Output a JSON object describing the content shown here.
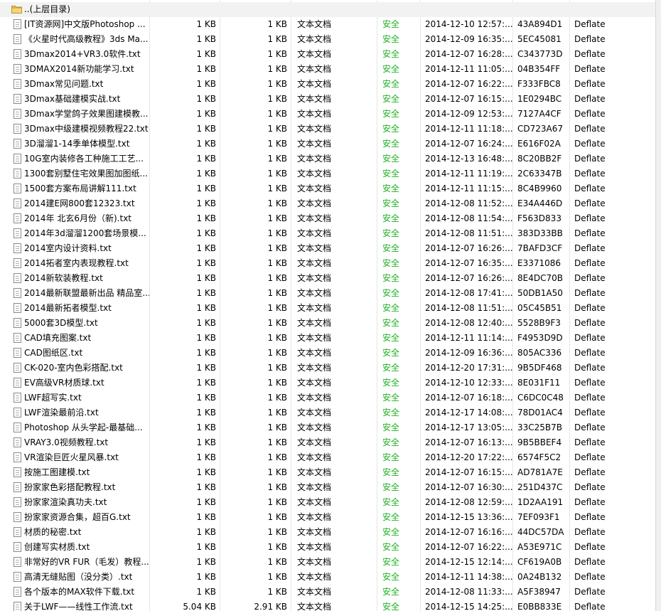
{
  "parent_row": {
    "name": "..(上层目录)",
    "icon": "folder-up-icon"
  },
  "colors": {
    "safe": "#1fb021",
    "parent_bg": "#f2f2f2"
  },
  "rows": [
    {
      "name": "[IT资源网]中文版Photoshop ...",
      "size": "1 KB",
      "packed": "1 KB",
      "type": "文本文档",
      "attr": "安全",
      "modified": "2014-12-10 12:57:...",
      "crc": "43A894D1",
      "method": "Deflate"
    },
    {
      "name": "《火星时代高级教程》3ds Ma...",
      "size": "1 KB",
      "packed": "1 KB",
      "type": "文本文档",
      "attr": "安全",
      "modified": "2014-12-09 16:35:...",
      "crc": "5EC45081",
      "method": "Deflate"
    },
    {
      "name": "3Dmax2014+VR3.0软件.txt",
      "size": "1 KB",
      "packed": "1 KB",
      "type": "文本文档",
      "attr": "安全",
      "modified": "2014-12-07 16:28:...",
      "crc": "C343773D",
      "method": "Deflate"
    },
    {
      "name": "3DMAX2014新功能学习.txt",
      "size": "1 KB",
      "packed": "1 KB",
      "type": "文本文档",
      "attr": "安全",
      "modified": "2014-12-11 11:05:...",
      "crc": "04B354FF",
      "method": "Deflate"
    },
    {
      "name": "3Dmax常见问题.txt",
      "size": "1 KB",
      "packed": "1 KB",
      "type": "文本文档",
      "attr": "安全",
      "modified": "2014-12-07 16:22:...",
      "crc": "F333FBC8",
      "method": "Deflate"
    },
    {
      "name": "3Dmax基础建模实战.txt",
      "size": "1 KB",
      "packed": "1 KB",
      "type": "文本文档",
      "attr": "安全",
      "modified": "2014-12-07 16:15:...",
      "crc": "1E0294BC",
      "method": "Deflate"
    },
    {
      "name": "3Dmax学堂鸽子效果图建模教...",
      "size": "1 KB",
      "packed": "1 KB",
      "type": "文本文档",
      "attr": "安全",
      "modified": "2014-12-09 12:53:...",
      "crc": "7127A4CF",
      "method": "Deflate"
    },
    {
      "name": "3Dmax中级建模视频教程22.txt",
      "size": "1 KB",
      "packed": "1 KB",
      "type": "文本文档",
      "attr": "安全",
      "modified": "2014-12-11 11:18:...",
      "crc": "CD723A67",
      "method": "Deflate"
    },
    {
      "name": "3D溜溜1-14季单体模型.txt",
      "size": "1 KB",
      "packed": "1 KB",
      "type": "文本文档",
      "attr": "安全",
      "modified": "2014-12-07 16:24:...",
      "crc": "E616F02A",
      "method": "Deflate"
    },
    {
      "name": "10G室内装修各工种施工工艺...",
      "size": "1 KB",
      "packed": "1 KB",
      "type": "文本文档",
      "attr": "安全",
      "modified": "2014-12-13 16:48:...",
      "crc": "8C20BB2F",
      "method": "Deflate"
    },
    {
      "name": "1300套别墅住宅效果图加图纸...",
      "size": "1 KB",
      "packed": "1 KB",
      "type": "文本文档",
      "attr": "安全",
      "modified": "2014-12-11 11:19:...",
      "crc": "2C63347B",
      "method": "Deflate"
    },
    {
      "name": "1500套方案布局讲解111.txt",
      "size": "1 KB",
      "packed": "1 KB",
      "type": "文本文档",
      "attr": "安全",
      "modified": "2014-12-11 11:15:...",
      "crc": "8C4B9960",
      "method": "Deflate"
    },
    {
      "name": "2014建E网800套12323.txt",
      "size": "1 KB",
      "packed": "1 KB",
      "type": "文本文档",
      "attr": "安全",
      "modified": "2014-12-08 11:52:...",
      "crc": "E34A446D",
      "method": "Deflate"
    },
    {
      "name": "2014年 北玄6月份（新).txt",
      "size": "1 KB",
      "packed": "1 KB",
      "type": "文本文档",
      "attr": "安全",
      "modified": "2014-12-08 11:54:...",
      "crc": "F563D833",
      "method": "Deflate"
    },
    {
      "name": "2014年3d溜溜1200套场景模...",
      "size": "1 KB",
      "packed": "1 KB",
      "type": "文本文档",
      "attr": "安全",
      "modified": "2014-12-08 11:51:...",
      "crc": "383D33BB",
      "method": "Deflate"
    },
    {
      "name": "2014室内设计资料.txt",
      "size": "1 KB",
      "packed": "1 KB",
      "type": "文本文档",
      "attr": "安全",
      "modified": "2014-12-07 16:26:...",
      "crc": "7BAFD3CF",
      "method": "Deflate"
    },
    {
      "name": "2014拓者室内表现教程.txt",
      "size": "1 KB",
      "packed": "1 KB",
      "type": "文本文档",
      "attr": "安全",
      "modified": "2014-12-07 16:35:...",
      "crc": "E3371086",
      "method": "Deflate"
    },
    {
      "name": "2014新软装教程.txt",
      "size": "1 KB",
      "packed": "1 KB",
      "type": "文本文档",
      "attr": "安全",
      "modified": "2014-12-07 16:26:...",
      "crc": "8E4DC70B",
      "method": "Deflate"
    },
    {
      "name": "2014最新联盟最新出品 精品室...",
      "size": "1 KB",
      "packed": "1 KB",
      "type": "文本文档",
      "attr": "安全",
      "modified": "2014-12-08 17:41:...",
      "crc": "50DB1A50",
      "method": "Deflate"
    },
    {
      "name": "2014最新拓者模型.txt",
      "size": "1 KB",
      "packed": "1 KB",
      "type": "文本文档",
      "attr": "安全",
      "modified": "2014-12-08 11:51:...",
      "crc": "05C45B51",
      "method": "Deflate"
    },
    {
      "name": "5000套3D模型.txt",
      "size": "1 KB",
      "packed": "1 KB",
      "type": "文本文档",
      "attr": "安全",
      "modified": "2014-12-08 12:40:...",
      "crc": "5528B9F3",
      "method": "Deflate"
    },
    {
      "name": "CAD填充图案.txt",
      "size": "1 KB",
      "packed": "1 KB",
      "type": "文本文档",
      "attr": "安全",
      "modified": "2014-12-11 11:14:...",
      "crc": "F4953D9D",
      "method": "Deflate"
    },
    {
      "name": "CAD图纸区.txt",
      "size": "1 KB",
      "packed": "1 KB",
      "type": "文本文档",
      "attr": "安全",
      "modified": "2014-12-09 16:36:...",
      "crc": "805AC336",
      "method": "Deflate"
    },
    {
      "name": "CK-020-室内色彩搭配.txt",
      "size": "1 KB",
      "packed": "1 KB",
      "type": "文本文档",
      "attr": "安全",
      "modified": "2014-12-20 17:31:...",
      "crc": "9B5DF468",
      "method": "Deflate"
    },
    {
      "name": "EV高级VR材质球.txt",
      "size": "1 KB",
      "packed": "1 KB",
      "type": "文本文档",
      "attr": "安全",
      "modified": "2014-12-10 12:33:...",
      "crc": "8E031F11",
      "method": "Deflate"
    },
    {
      "name": "LWF超写实.txt",
      "size": "1 KB",
      "packed": "1 KB",
      "type": "文本文档",
      "attr": "安全",
      "modified": "2014-12-07 16:18:...",
      "crc": "C6DC0C48",
      "method": "Deflate"
    },
    {
      "name": "LWF渲染最前沿.txt",
      "size": "1 KB",
      "packed": "1 KB",
      "type": "文本文档",
      "attr": "安全",
      "modified": "2014-12-17 14:08:...",
      "crc": "78D01AC4",
      "method": "Deflate"
    },
    {
      "name": "Photoshop 从头学起-最基础...",
      "size": "1 KB",
      "packed": "1 KB",
      "type": "文本文档",
      "attr": "安全",
      "modified": "2014-12-17 13:05:...",
      "crc": "33C25B7B",
      "method": "Deflate"
    },
    {
      "name": "VRAY3.0视频教程.txt",
      "size": "1 KB",
      "packed": "1 KB",
      "type": "文本文档",
      "attr": "安全",
      "modified": "2014-12-07 16:13:...",
      "crc": "9B5BBEF4",
      "method": "Deflate"
    },
    {
      "name": "VR渲染巨匠火星风暴.txt",
      "size": "1 KB",
      "packed": "1 KB",
      "type": "文本文档",
      "attr": "安全",
      "modified": "2014-12-20 17:22:...",
      "crc": "6574F5C2",
      "method": "Deflate"
    },
    {
      "name": "按施工图建模.txt",
      "size": "1 KB",
      "packed": "1 KB",
      "type": "文本文档",
      "attr": "安全",
      "modified": "2014-12-07 16:15:...",
      "crc": "AD781A7E",
      "method": "Deflate"
    },
    {
      "name": "扮家家色彩搭配教程.txt",
      "size": "1 KB",
      "packed": "1 KB",
      "type": "文本文档",
      "attr": "安全",
      "modified": "2014-12-07 16:30:...",
      "crc": "251D437C",
      "method": "Deflate"
    },
    {
      "name": "扮家家渲染真功夫.txt",
      "size": "1 KB",
      "packed": "1 KB",
      "type": "文本文档",
      "attr": "安全",
      "modified": "2014-12-08 12:59:...",
      "crc": "1D2AA191",
      "method": "Deflate"
    },
    {
      "name": "扮家家资源合集，超百G.txt",
      "size": "1 KB",
      "packed": "1 KB",
      "type": "文本文档",
      "attr": "安全",
      "modified": "2014-12-15 13:36:...",
      "crc": "7EF093F1",
      "method": "Deflate"
    },
    {
      "name": "材质的秘密.txt",
      "size": "1 KB",
      "packed": "1 KB",
      "type": "文本文档",
      "attr": "安全",
      "modified": "2014-12-07 16:16:...",
      "crc": "44DC57DA",
      "method": "Deflate"
    },
    {
      "name": "创建写实材质.txt",
      "size": "1 KB",
      "packed": "1 KB",
      "type": "文本文档",
      "attr": "安全",
      "modified": "2014-12-07 16:22:...",
      "crc": "A53E971C",
      "method": "Deflate"
    },
    {
      "name": "非常好的VR FUR（毛发）教程...",
      "size": "1 KB",
      "packed": "1 KB",
      "type": "文本文档",
      "attr": "安全",
      "modified": "2014-12-15 12:14:...",
      "crc": "CF619A0B",
      "method": "Deflate"
    },
    {
      "name": "高清无缝贴图（没分类）.txt",
      "size": "1 KB",
      "packed": "1 KB",
      "type": "文本文档",
      "attr": "安全",
      "modified": "2014-12-11 14:38:...",
      "crc": "0A24B132",
      "method": "Deflate"
    },
    {
      "name": "各个版本的MAX软件下载.txt",
      "size": "1 KB",
      "packed": "1 KB",
      "type": "文本文档",
      "attr": "安全",
      "modified": "2014-12-08 11:33:...",
      "crc": "A5F38947",
      "method": "Deflate"
    },
    {
      "name": "关于LWF——线性工作流.txt",
      "size": "5.04 KB",
      "packed": "2.91 KB",
      "type": "文本文档",
      "attr": "安全",
      "modified": "2014-12-15 14:25:...",
      "crc": "E0BB833E",
      "method": "Deflate"
    }
  ]
}
